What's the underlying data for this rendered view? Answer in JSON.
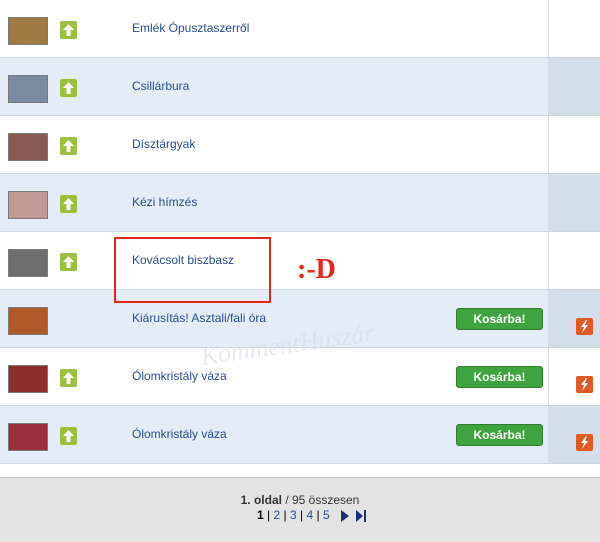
{
  "rows": [
    {
      "title": "Emlék Ópusztaszerről",
      "alt": false,
      "thumb_color": "#a07a44",
      "cart": null,
      "flash": false
    },
    {
      "title": "Csillárbura",
      "alt": true,
      "thumb_color": "#7a8aa0",
      "cart": null,
      "flash": false
    },
    {
      "title": "Dísztárgyak",
      "alt": false,
      "thumb_color": "#8a5a52",
      "cart": null,
      "flash": false
    },
    {
      "title": "Kézi hímzés",
      "alt": true,
      "thumb_color": "#c39a93",
      "cart": null,
      "flash": false
    },
    {
      "title": "Kovácsolt biszbasz",
      "alt": false,
      "thumb_color": "#6e6e6e",
      "cart": null,
      "flash": false
    },
    {
      "title": "Kiárusítás! Asztali/fali óra",
      "alt": true,
      "thumb_color": "#b05a2a",
      "cart": "Kosárba!",
      "flash": true
    },
    {
      "title": "Ólomkristály váza",
      "alt": false,
      "thumb_color": "#8a2e2e",
      "cart": "Kosárba!",
      "flash": true
    },
    {
      "title": "Ólomkristály váza",
      "alt": true,
      "thumb_color": "#9a2e3a",
      "cart": "Kosárba!",
      "flash": true
    }
  ],
  "annotation": {
    "emoticon": ":-D"
  },
  "footer": {
    "page_label": "1. oldal",
    "total_text": "/ 95 összesen",
    "pages": [
      "1",
      "2",
      "3",
      "4",
      "5"
    ],
    "current_page": "1"
  },
  "watermark": "KommentHuszár",
  "colors": {
    "accent_green": "#3fa43f",
    "link_blue": "#2b4c8c",
    "annotation_red": "#e8251b",
    "flash_orange": "#e05a21",
    "row_alt": "#e3ecf7"
  }
}
